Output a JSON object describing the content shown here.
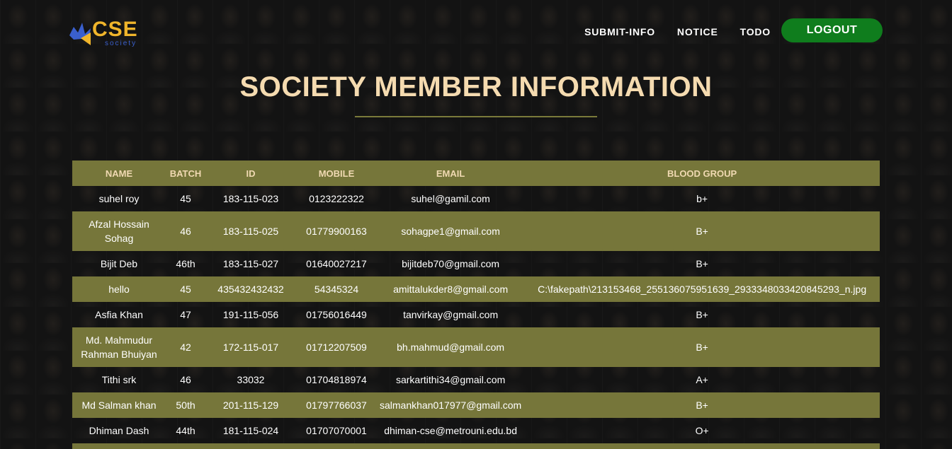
{
  "brand": {
    "logo_text": "CSE",
    "logo_sub": "society",
    "colors": {
      "logo": "#f0b52b",
      "sub": "#3a5fcd"
    }
  },
  "nav": {
    "items": [
      {
        "label": "SUBMIT-INFO"
      },
      {
        "label": "NOTICE"
      },
      {
        "label": "TODO"
      }
    ],
    "logout_label": "LOGOUT",
    "logout_color": "#0f7d1d"
  },
  "page": {
    "title": "SOCIETY MEMBER INFORMATION"
  },
  "table": {
    "headers": [
      "NAME",
      "BATCH",
      "ID",
      "MOBILE",
      "EMAIL",
      "BLOOD GROUP"
    ],
    "rows": [
      [
        "suhel roy",
        "45",
        "183-115-023",
        "0123222322",
        "suhel@gamil.com",
        "b+"
      ],
      [
        "Afzal Hossain Sohag",
        "46",
        "183-115-025",
        "01779900163",
        "sohagpe1@gmail.com",
        "B+"
      ],
      [
        "Bijit Deb",
        "46th",
        "183-115-027",
        "01640027217",
        "bijitdeb70@gmail.com",
        "B+"
      ],
      [
        "hello",
        "45",
        "435432432432",
        "54345324",
        "amittalukder8@gmail.com",
        "C:\\fakepath\\213153468_255136075951639_2933348033420845293_n.jpg"
      ],
      [
        "Asfia Khan",
        "47",
        "191-115-056",
        "01756016449",
        "tanvirkay@gmail.com",
        "B+"
      ],
      [
        "Md. Mahmudur Rahman Bhuiyan",
        "42",
        "172-115-017",
        "01712207509",
        "bh.mahmud@gmail.com",
        "B+"
      ],
      [
        "Tithi srk",
        "46",
        "33032",
        "01704818974",
        "sarkartithi34@gmail.com",
        "A+"
      ],
      [
        "Md Salman khan",
        "50th",
        "201-115-129",
        "01797766037",
        "salmankhan017977@gmail.com",
        "B+"
      ],
      [
        "Dhiman Dash",
        "44th",
        "181-115-024",
        "01707070001",
        "dhiman-cse@metrouni.edu.bd",
        "O+"
      ],
      [
        "",
        "",
        "",
        "",
        "",
        ""
      ]
    ]
  },
  "colors": {
    "row_band": "#76763a",
    "title": "#f5dbb0",
    "header_text": "#f0d9b2"
  }
}
